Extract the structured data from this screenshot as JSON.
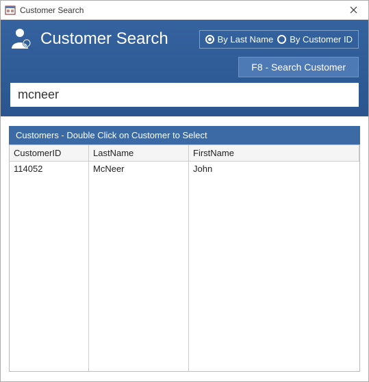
{
  "window": {
    "title": "Customer Search"
  },
  "header": {
    "title": "Customer Search",
    "radios": {
      "byLastName": "By Last Name",
      "byCustomerId": "By Customer ID",
      "selected": "byLastName"
    },
    "searchButton": "F8 - Search Customer",
    "searchValue": "mcneer"
  },
  "table": {
    "caption": "Customers - Double Click on Customer to Select",
    "columns": {
      "customerId": "CustomerID",
      "lastName": "LastName",
      "firstName": "FirstName"
    },
    "rows": [
      {
        "customerId": "114052",
        "lastName": "McNeer",
        "firstName": "John"
      }
    ]
  }
}
